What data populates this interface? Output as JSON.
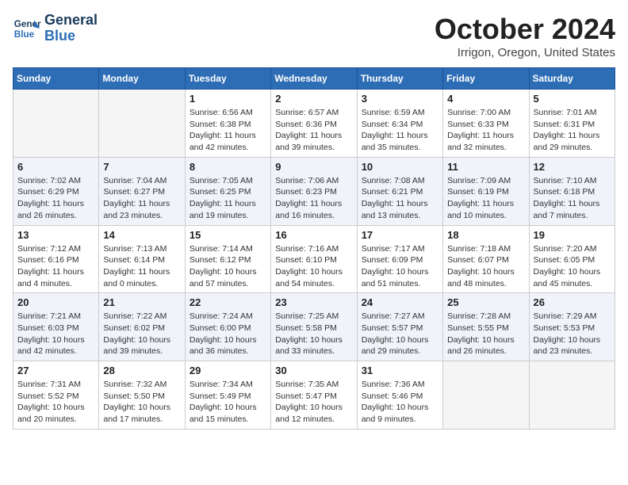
{
  "logo": {
    "line1": "General",
    "line2": "Blue"
  },
  "title": "October 2024",
  "location": "Irrigon, Oregon, United States",
  "days_of_week": [
    "Sunday",
    "Monday",
    "Tuesday",
    "Wednesday",
    "Thursday",
    "Friday",
    "Saturday"
  ],
  "weeks": [
    [
      {
        "day": "",
        "info": ""
      },
      {
        "day": "",
        "info": ""
      },
      {
        "day": "1",
        "info": "Sunrise: 6:56 AM\nSunset: 6:38 PM\nDaylight: 11 hours and 42 minutes."
      },
      {
        "day": "2",
        "info": "Sunrise: 6:57 AM\nSunset: 6:36 PM\nDaylight: 11 hours and 39 minutes."
      },
      {
        "day": "3",
        "info": "Sunrise: 6:59 AM\nSunset: 6:34 PM\nDaylight: 11 hours and 35 minutes."
      },
      {
        "day": "4",
        "info": "Sunrise: 7:00 AM\nSunset: 6:33 PM\nDaylight: 11 hours and 32 minutes."
      },
      {
        "day": "5",
        "info": "Sunrise: 7:01 AM\nSunset: 6:31 PM\nDaylight: 11 hours and 29 minutes."
      }
    ],
    [
      {
        "day": "6",
        "info": "Sunrise: 7:02 AM\nSunset: 6:29 PM\nDaylight: 11 hours and 26 minutes."
      },
      {
        "day": "7",
        "info": "Sunrise: 7:04 AM\nSunset: 6:27 PM\nDaylight: 11 hours and 23 minutes."
      },
      {
        "day": "8",
        "info": "Sunrise: 7:05 AM\nSunset: 6:25 PM\nDaylight: 11 hours and 19 minutes."
      },
      {
        "day": "9",
        "info": "Sunrise: 7:06 AM\nSunset: 6:23 PM\nDaylight: 11 hours and 16 minutes."
      },
      {
        "day": "10",
        "info": "Sunrise: 7:08 AM\nSunset: 6:21 PM\nDaylight: 11 hours and 13 minutes."
      },
      {
        "day": "11",
        "info": "Sunrise: 7:09 AM\nSunset: 6:19 PM\nDaylight: 11 hours and 10 minutes."
      },
      {
        "day": "12",
        "info": "Sunrise: 7:10 AM\nSunset: 6:18 PM\nDaylight: 11 hours and 7 minutes."
      }
    ],
    [
      {
        "day": "13",
        "info": "Sunrise: 7:12 AM\nSunset: 6:16 PM\nDaylight: 11 hours and 4 minutes."
      },
      {
        "day": "14",
        "info": "Sunrise: 7:13 AM\nSunset: 6:14 PM\nDaylight: 11 hours and 0 minutes."
      },
      {
        "day": "15",
        "info": "Sunrise: 7:14 AM\nSunset: 6:12 PM\nDaylight: 10 hours and 57 minutes."
      },
      {
        "day": "16",
        "info": "Sunrise: 7:16 AM\nSunset: 6:10 PM\nDaylight: 10 hours and 54 minutes."
      },
      {
        "day": "17",
        "info": "Sunrise: 7:17 AM\nSunset: 6:09 PM\nDaylight: 10 hours and 51 minutes."
      },
      {
        "day": "18",
        "info": "Sunrise: 7:18 AM\nSunset: 6:07 PM\nDaylight: 10 hours and 48 minutes."
      },
      {
        "day": "19",
        "info": "Sunrise: 7:20 AM\nSunset: 6:05 PM\nDaylight: 10 hours and 45 minutes."
      }
    ],
    [
      {
        "day": "20",
        "info": "Sunrise: 7:21 AM\nSunset: 6:03 PM\nDaylight: 10 hours and 42 minutes."
      },
      {
        "day": "21",
        "info": "Sunrise: 7:22 AM\nSunset: 6:02 PM\nDaylight: 10 hours and 39 minutes."
      },
      {
        "day": "22",
        "info": "Sunrise: 7:24 AM\nSunset: 6:00 PM\nDaylight: 10 hours and 36 minutes."
      },
      {
        "day": "23",
        "info": "Sunrise: 7:25 AM\nSunset: 5:58 PM\nDaylight: 10 hours and 33 minutes."
      },
      {
        "day": "24",
        "info": "Sunrise: 7:27 AM\nSunset: 5:57 PM\nDaylight: 10 hours and 29 minutes."
      },
      {
        "day": "25",
        "info": "Sunrise: 7:28 AM\nSunset: 5:55 PM\nDaylight: 10 hours and 26 minutes."
      },
      {
        "day": "26",
        "info": "Sunrise: 7:29 AM\nSunset: 5:53 PM\nDaylight: 10 hours and 23 minutes."
      }
    ],
    [
      {
        "day": "27",
        "info": "Sunrise: 7:31 AM\nSunset: 5:52 PM\nDaylight: 10 hours and 20 minutes."
      },
      {
        "day": "28",
        "info": "Sunrise: 7:32 AM\nSunset: 5:50 PM\nDaylight: 10 hours and 17 minutes."
      },
      {
        "day": "29",
        "info": "Sunrise: 7:34 AM\nSunset: 5:49 PM\nDaylight: 10 hours and 15 minutes."
      },
      {
        "day": "30",
        "info": "Sunrise: 7:35 AM\nSunset: 5:47 PM\nDaylight: 10 hours and 12 minutes."
      },
      {
        "day": "31",
        "info": "Sunrise: 7:36 AM\nSunset: 5:46 PM\nDaylight: 10 hours and 9 minutes."
      },
      {
        "day": "",
        "info": ""
      },
      {
        "day": "",
        "info": ""
      }
    ]
  ]
}
